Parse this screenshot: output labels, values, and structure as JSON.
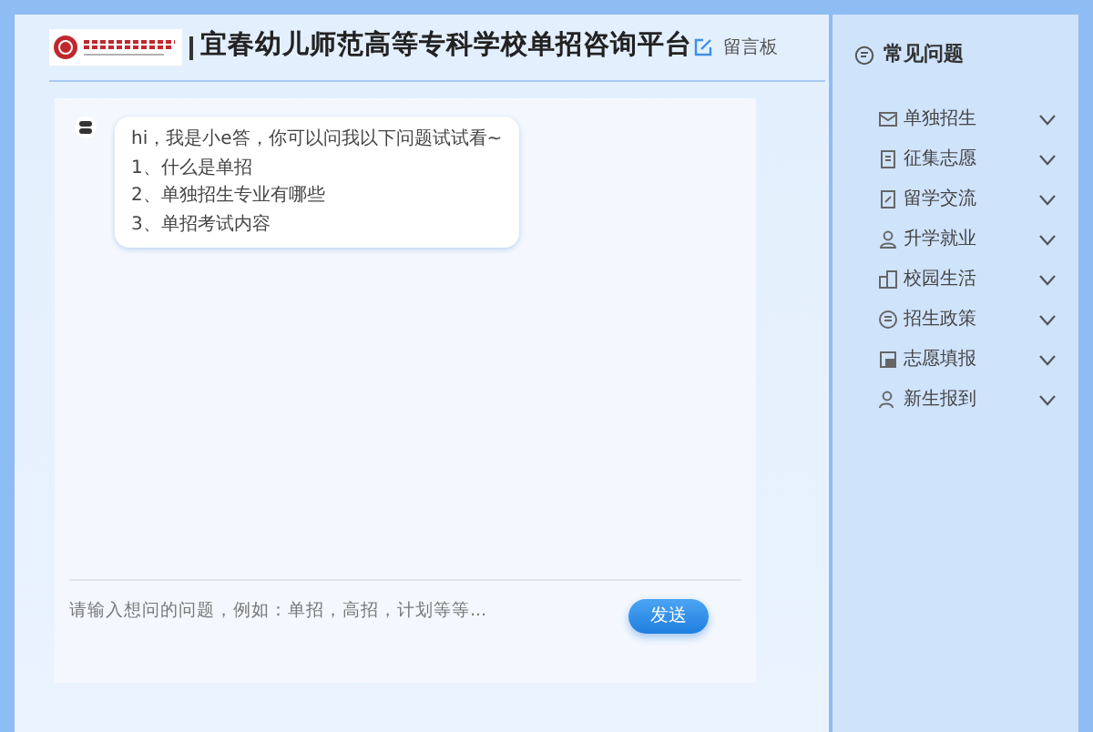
{
  "header": {
    "title": "宜春幼儿师范高等专科学校单招咨询平台",
    "message_board": "留言板"
  },
  "chat": {
    "messages": [
      {
        "kind": "bot",
        "lines": [
          "hi，我是小e答，你可以问我以下问题试试看~",
          "1、什么是单招",
          "2、单独招生专业有哪些",
          "3、单招考试内容"
        ]
      }
    ],
    "input": {
      "placeholder": "请输入想问的问题，例如：单招，高招，计划等等..."
    },
    "send_button": "发送"
  },
  "sidebar": {
    "title": "常见问题",
    "items": [
      {
        "label": "单独招生",
        "expanded": false
      },
      {
        "label": "征集志愿",
        "expanded": false
      },
      {
        "label": "留学交流",
        "expanded": false
      },
      {
        "label": "升学就业",
        "expanded": false
      },
      {
        "label": "校园生活",
        "expanded": false
      },
      {
        "label": "招生政策",
        "expanded": false
      },
      {
        "label": "志愿填报",
        "expanded": false
      },
      {
        "label": "新生报到",
        "expanded": false
      }
    ]
  }
}
